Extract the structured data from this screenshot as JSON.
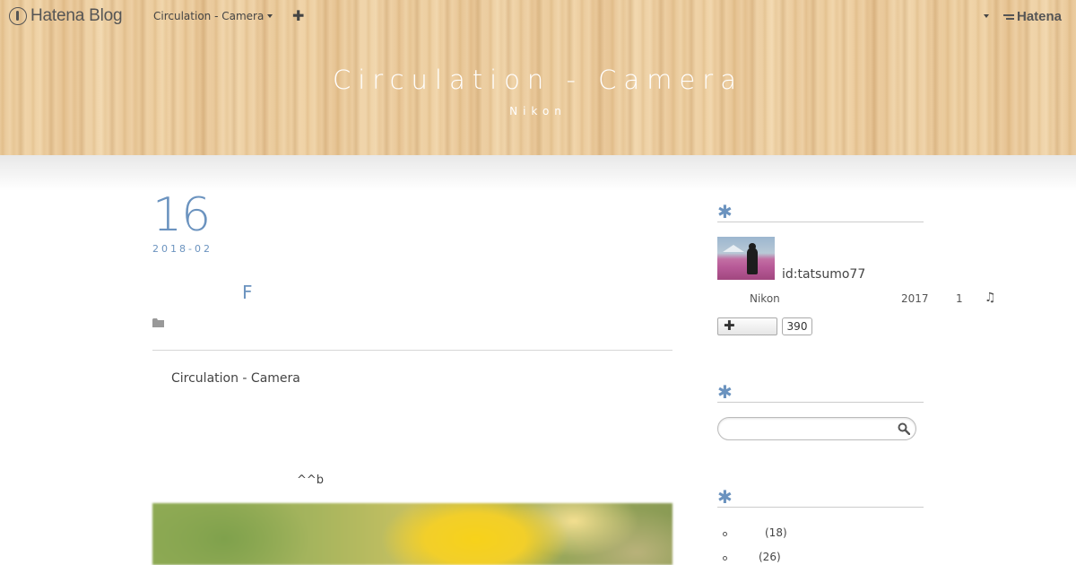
{
  "toolbar": {
    "brand": "Hatena Blog",
    "blog_menu": "Circulation - Camera",
    "add_label": "✚",
    "hatena": "Hatena"
  },
  "header": {
    "title": "Circulation - Camera",
    "description": "Nikon"
  },
  "entry": {
    "day": "16",
    "year_month": "2018-02",
    "title": "F",
    "text1": "Circulation - Camera",
    "text2": "^^b"
  },
  "sidebar": {
    "profile_heading": "✱",
    "profile": {
      "id": "id:tatsumo77",
      "camera": "Nikon",
      "year": "2017",
      "count": "1",
      "note": "♫",
      "follow_label": "✚",
      "followers": "390"
    },
    "search_heading": "✱",
    "search_placeholder": "",
    "categories_heading": "✱",
    "categories": [
      {
        "count": "(18)"
      },
      {
        "count": "(26)"
      }
    ]
  },
  "colors": {
    "accent": "#6b93bf",
    "header_wood": "#e9c99a"
  }
}
